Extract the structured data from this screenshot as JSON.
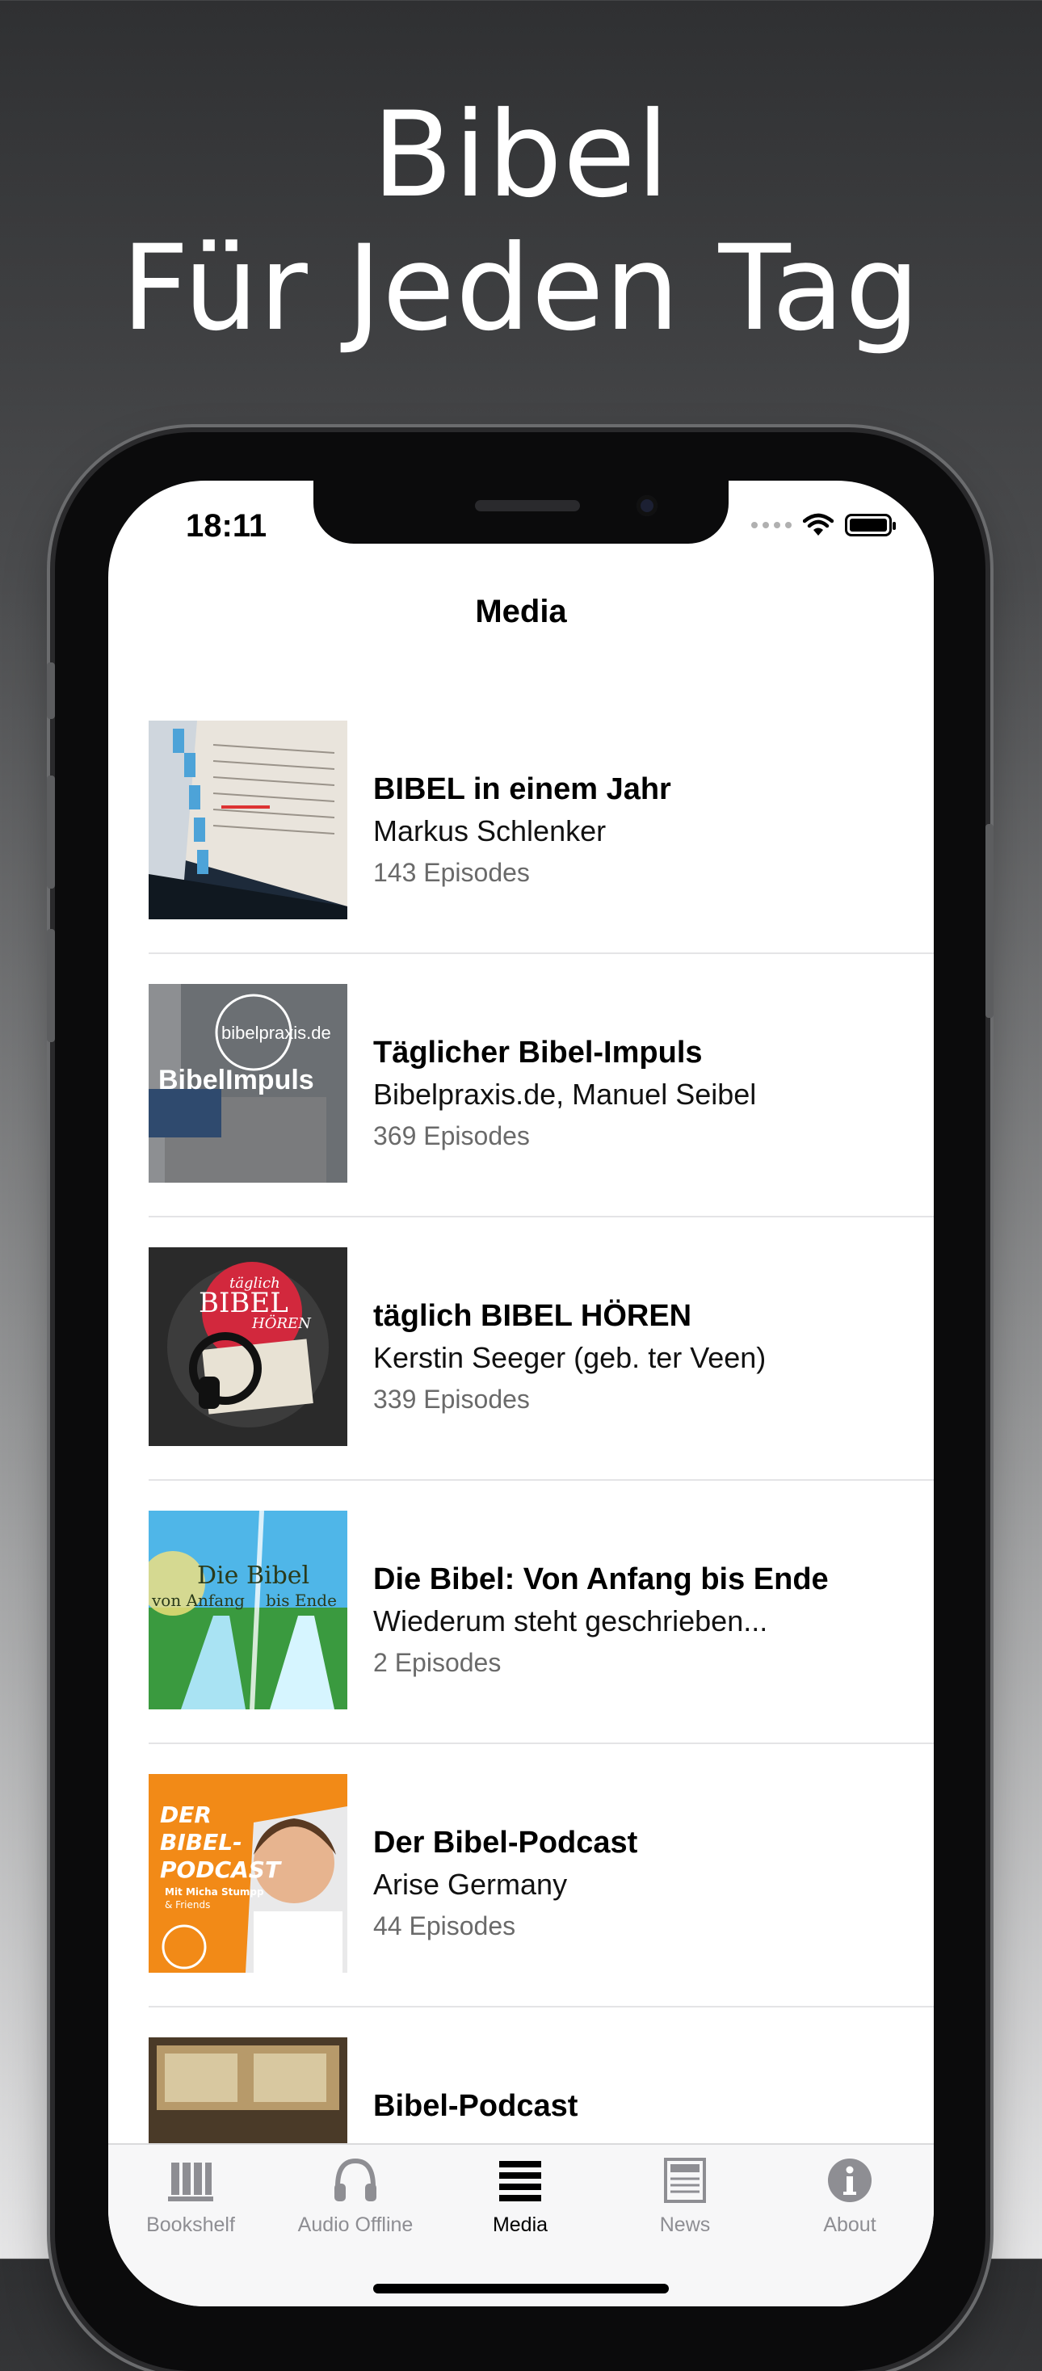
{
  "headline": {
    "line1": "Bibel",
    "line2": "Für Jeden Tag"
  },
  "status_bar": {
    "time": "18:11"
  },
  "nav": {
    "title": "Media"
  },
  "podcasts": [
    {
      "title": "BIBEL in einem Jahr",
      "author": "Markus Schlenker",
      "episodes": "143 Episodes"
    },
    {
      "title": "Täglicher Bibel-Impuls",
      "author": "Bibelpraxis.de, Manuel Seibel",
      "episodes": "369 Episodes",
      "cover_text": "bibelpraxis.de",
      "cover_text2": "BibelImpuls"
    },
    {
      "title": "täglich BIBEL HÖREN",
      "author": "Kerstin Seeger (geb. ter Veen)",
      "episodes": "339 Episodes",
      "cover_text": "täglich",
      "cover_text2": "BIBEL",
      "cover_text3": "HÖREN"
    },
    {
      "title": "Die Bibel: Von Anfang bis Ende",
      "author": "Wiederum steht geschrieben...",
      "episodes": "2 Episodes",
      "cover_text": "Die Bibel",
      "cover_text2": "von Anfang",
      "cover_text3": "bis Ende"
    },
    {
      "title": "Der Bibel-Podcast",
      "author": "Arise Germany",
      "episodes": "44 Episodes",
      "cover_text": "DER",
      "cover_text2": "BIBEL-",
      "cover_text3": "PODCAST",
      "cover_text4": "Mit Micha Stumpp",
      "cover_text5": "& Friends"
    },
    {
      "title": "Bibel-Podcast",
      "author": "",
      "episodes": ""
    }
  ],
  "tabs": [
    {
      "label": "Bookshelf",
      "icon": "bookshelf-icon"
    },
    {
      "label": "Audio Offline",
      "icon": "headphones-icon"
    },
    {
      "label": "Media",
      "icon": "list-icon",
      "active": true
    },
    {
      "label": "News",
      "icon": "newspaper-icon"
    },
    {
      "label": "About",
      "icon": "info-icon"
    }
  ],
  "colors": {
    "accent_active": "#000000",
    "tab_inactive": "#8e8e93",
    "arise_orange": "#f28a17"
  }
}
